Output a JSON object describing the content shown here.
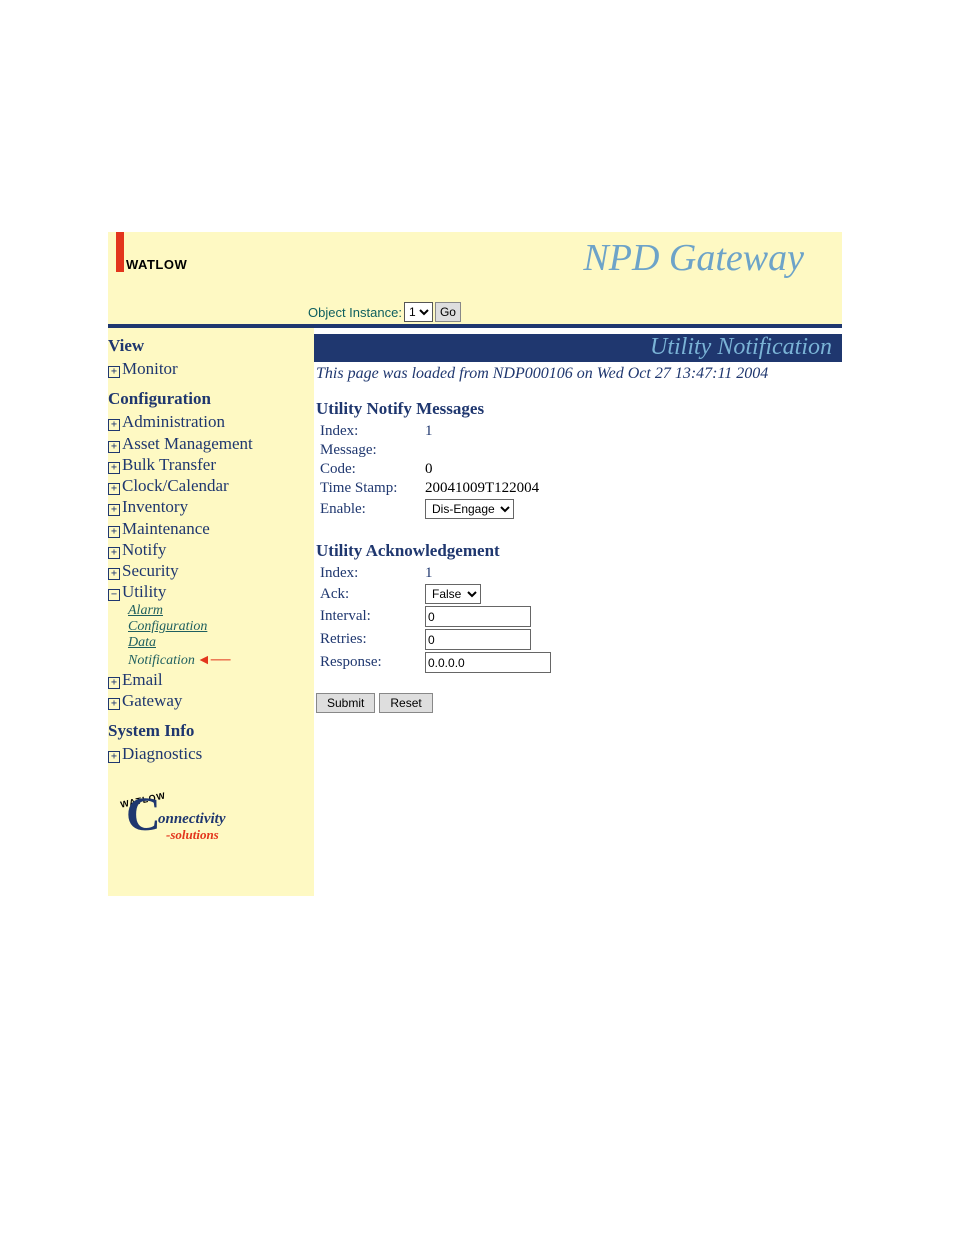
{
  "header": {
    "brand": "WATLOW",
    "app_title": "NPD Gateway",
    "instance_label": "Object Instance:",
    "instance_value": "1",
    "go_label": "Go"
  },
  "sidebar": {
    "heading_view": "View",
    "heading_config": "Configuration",
    "heading_sysinfo": "System Info",
    "items_view": [
      "Monitor"
    ],
    "items_config": [
      "Administration",
      "Asset Management",
      "Bulk Transfer",
      "Clock/Calendar",
      "Inventory",
      "Maintenance",
      "Notify",
      "Security",
      "Utility",
      "Email",
      "Gateway"
    ],
    "utility_sub": [
      "Alarm",
      "Configuration",
      "Data",
      "Notification"
    ],
    "items_sysinfo": [
      "Diagnostics"
    ],
    "footer": {
      "arc": "WATLOW",
      "conn": "onnectivity",
      "sol": "-solutions"
    }
  },
  "main": {
    "page_title": "Utility Notification",
    "load_text": "This page was loaded from NDP000106 on Wed Oct 27 13:47:11 2004",
    "section_notify": "Utility Notify Messages",
    "notify_fields": {
      "index_label": "Index:",
      "index_value": "1",
      "message_label": "Message:",
      "code_label": "Code:",
      "code_value": "0",
      "ts_label": "Time Stamp:",
      "ts_value": "20041009T122004",
      "enable_label": "Enable:",
      "enable_value": "Dis-Engage"
    },
    "section_ack": "Utility Acknowledgement",
    "ack_fields": {
      "index_label": "Index:",
      "index_value": "1",
      "ack_label": "Ack:",
      "ack_value": "False",
      "interval_label": "Interval:",
      "interval_value": "0",
      "retries_label": "Retries:",
      "retries_value": "0",
      "response_label": "Response:",
      "response_value": "0.0.0.0"
    },
    "submit_label": "Submit",
    "reset_label": "Reset"
  }
}
